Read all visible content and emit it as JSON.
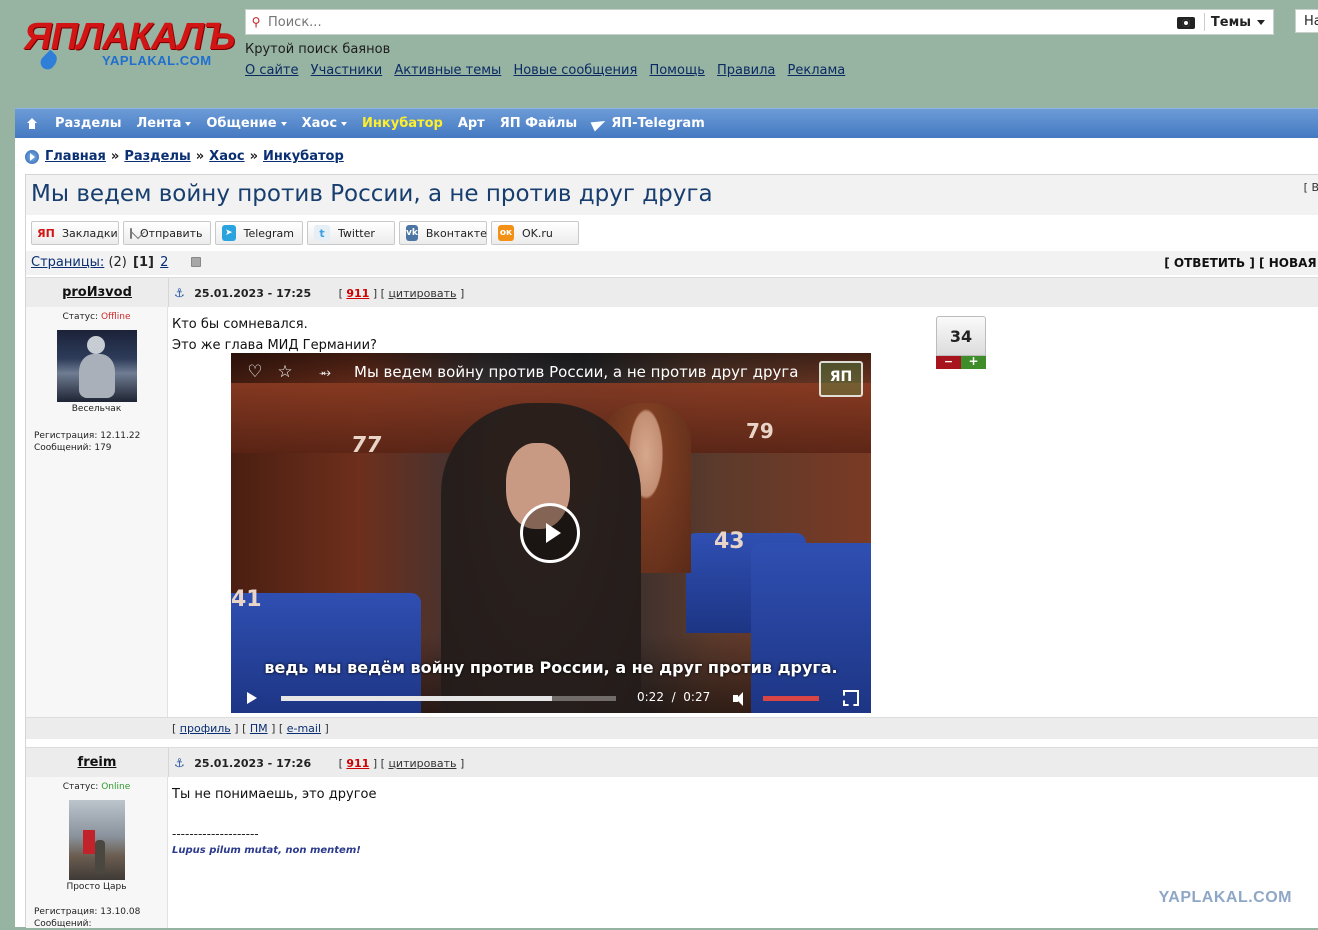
{
  "logo": {
    "main": "ЯПЛАКАЛЪ",
    "sub": "YAPLAKAL.COM"
  },
  "search": {
    "placeholder": "Поиск...",
    "themes_label": "Темы"
  },
  "top_right_btn": "На",
  "tagline": "Крутой поиск баянов",
  "top_links": [
    "О сайте",
    "Участники",
    "Активные темы",
    "Новые сообщения",
    "Помощь",
    "Правила",
    "Реклама"
  ],
  "nav": {
    "items": [
      {
        "label": "Разделы",
        "dropdown": false
      },
      {
        "label": "Лента",
        "dropdown": true
      },
      {
        "label": "Общение",
        "dropdown": true
      },
      {
        "label": "Хаос",
        "dropdown": true
      },
      {
        "label": "Инкубатор",
        "dropdown": false,
        "highlight": "#ffef2b"
      },
      {
        "label": "Арт",
        "dropdown": false
      },
      {
        "label": "ЯП Файлы",
        "dropdown": false
      },
      {
        "label": "ЯП-Telegram",
        "dropdown": false
      }
    ]
  },
  "breadcrumb": [
    "Главная",
    "Разделы",
    "Хаос",
    "Инкубатор"
  ],
  "breadcrumb_sep": "»",
  "topic": {
    "title": "Мы ведем войну против России, а не против друг друга",
    "right_bracket": "[ В"
  },
  "share_buttons": [
    {
      "label": "Закладки",
      "icon": "yaplakal-icon",
      "icon_text": "ЯП"
    },
    {
      "label": "Отправить",
      "icon": "mail-icon",
      "icon_text": ""
    },
    {
      "label": "Telegram",
      "icon": "telegram-icon",
      "icon_text": "➤"
    },
    {
      "label": "Twitter",
      "icon": "twitter-icon",
      "icon_text": "t"
    },
    {
      "label": "Вконтакте",
      "icon": "vk-icon",
      "icon_text": "vk"
    },
    {
      "label": "OK.ru",
      "icon": "ok-icon",
      "icon_text": "ок"
    }
  ],
  "pager": {
    "label": "Страницы:",
    "count": "(2)",
    "current": "[1]",
    "next": "2",
    "right": "[ ОТВЕТИТЬ ] [ НОВАЯ Т"
  },
  "posts": [
    {
      "author": "proИзvod",
      "status_label": "Статус:",
      "status": "Offline",
      "rank": "Весельчак",
      "reg_label": "Регистрация:",
      "reg": "12.11.22",
      "msgs_label": "Сообщений:",
      "msgs": "179",
      "date": "25.01.2023 - 17:25",
      "post_num": "911",
      "quote_label": "цитировать",
      "text": [
        "Кто бы сомневался.",
        "Это же глава МИД Германии?"
      ],
      "rating": "34",
      "video": {
        "title": "Мы ведем войну против России, а не против друг друга",
        "subtitle": "ведь мы ведём войну против России, а не друг против друга.",
        "current_time": "0:22",
        "duration": "0:27",
        "progress": 0.81,
        "watermark": "ЯП",
        "seat_numbers": [
          "77",
          "79",
          "43",
          "41"
        ]
      },
      "footer_links": [
        "профиль",
        "ПМ",
        "e-mail"
      ]
    },
    {
      "author": "freim",
      "status_label": "Статус:",
      "status": "Online",
      "rank": "Просто Царь",
      "reg_label": "Регистрация:",
      "reg": "13.10.08",
      "msgs_label": "Сообщений:",
      "msgs": "",
      "date": "25.01.2023 - 17:26",
      "post_num": "911",
      "quote_label": "цитировать",
      "text": [
        "Ты не понимаешь, это другое"
      ],
      "signature_line": "--------------------",
      "signature": "Lupus pilum mutat, non mentem!"
    }
  ],
  "bottom_watermark": "YAPLAKAL.COM"
}
